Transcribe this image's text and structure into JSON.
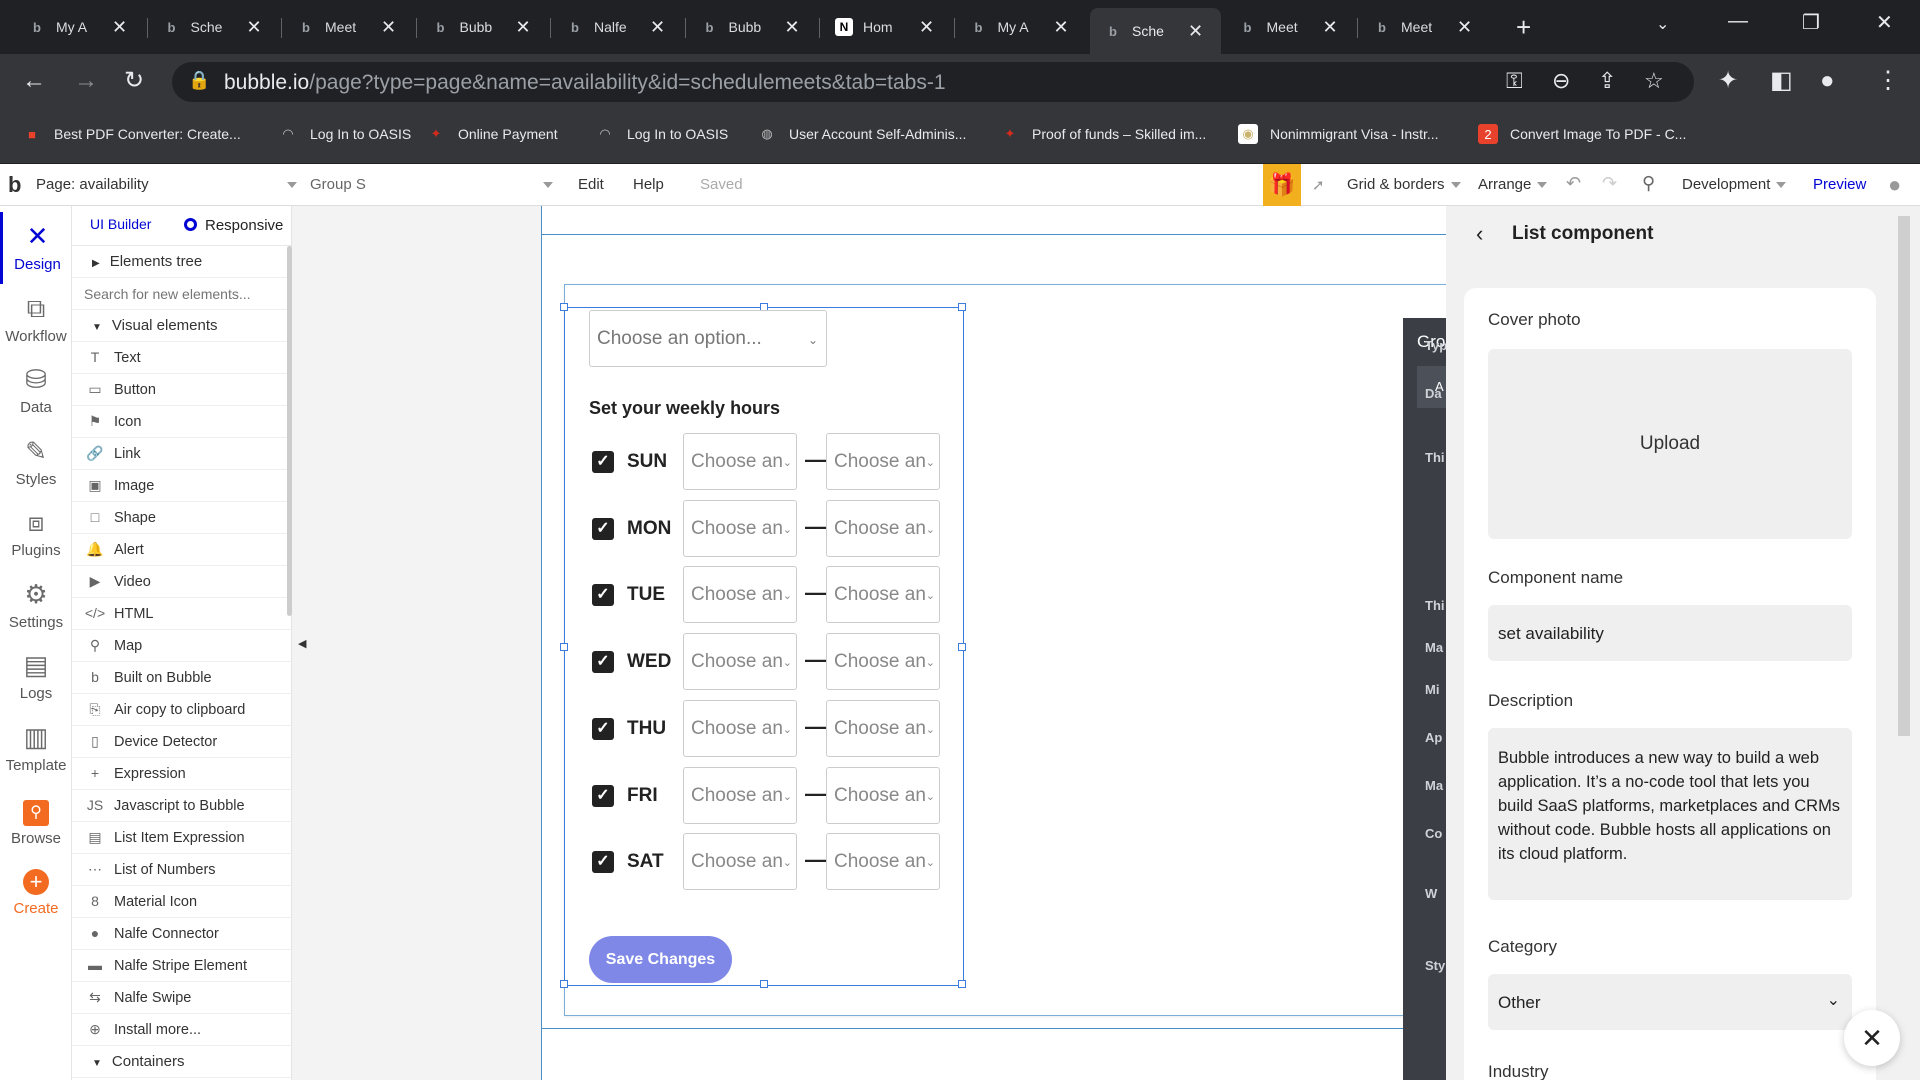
{
  "browser": {
    "tabs": [
      {
        "label": "My A",
        "icon": "b"
      },
      {
        "label": "Sche",
        "icon": "b"
      },
      {
        "label": "Meet",
        "icon": "b"
      },
      {
        "label": "Bubb",
        "icon": "b"
      },
      {
        "label": "Nalfe",
        "icon": "b"
      },
      {
        "label": "Bubb",
        "icon": "b"
      },
      {
        "label": "Hom",
        "icon": "N"
      },
      {
        "label": "My A",
        "icon": "b"
      },
      {
        "label": "Sche",
        "icon": "b"
      },
      {
        "label": "Meet",
        "icon": "b"
      },
      {
        "label": "Meet",
        "icon": "b"
      }
    ],
    "active_tab_index": 8,
    "url_host": "bubble.io",
    "url_path": "/page?type=page&name=availability&id=schedulemeets&tab=tabs-1",
    "bookmarks": [
      {
        "label": "Best PDF Converter: Create...",
        "icon": "pdf-icon"
      },
      {
        "label": "Log In to OASIS",
        "icon": "signal-icon"
      },
      {
        "label": "Online Payment",
        "icon": "maple-leaf-icon"
      },
      {
        "label": "Log In to OASIS",
        "icon": "signal-icon"
      },
      {
        "label": "User Account Self-Adminis...",
        "icon": "globe-icon"
      },
      {
        "label": "Proof of funds – Skilled im...",
        "icon": "maple-leaf-icon"
      },
      {
        "label": "Nonimmigrant Visa - Instr...",
        "icon": "seal-icon"
      },
      {
        "label": "Convert Image To PDF - C...",
        "icon": "convert-icon"
      }
    ]
  },
  "editor_header": {
    "page_label": "Page: availability",
    "group_label": "Group S",
    "menu_edit": "Edit",
    "menu_help": "Help",
    "save_status": "Saved",
    "grid_borders": "Grid & borders",
    "arrange": "Arrange",
    "environment": "Development",
    "preview": "Preview"
  },
  "rail": [
    {
      "label": "Design",
      "icon": "design-icon",
      "active": true
    },
    {
      "label": "Workflow",
      "icon": "workflow-icon"
    },
    {
      "label": "Data",
      "icon": "database-icon"
    },
    {
      "label": "Styles",
      "icon": "brush-icon"
    },
    {
      "label": "Plugins",
      "icon": "plugin-icon"
    },
    {
      "label": "Settings",
      "icon": "gear-icon"
    },
    {
      "label": "Logs",
      "icon": "document-icon"
    },
    {
      "label": "Template",
      "icon": "template-icon"
    },
    {
      "label": "Browse",
      "icon": "search-icon"
    },
    {
      "label": "Create",
      "icon": "plus-icon"
    }
  ],
  "palette": {
    "tab_ui_builder": "UI Builder",
    "tab_responsive": "Responsive",
    "elements_tree": "Elements tree",
    "search_placeholder": "Search for new elements...",
    "visual_elements": "Visual elements",
    "items": [
      {
        "label": "Text",
        "icon": "T"
      },
      {
        "label": "Button",
        "icon": "▭"
      },
      {
        "label": "Icon",
        "icon": "⚑"
      },
      {
        "label": "Link",
        "icon": "🔗"
      },
      {
        "label": "Image",
        "icon": "▣"
      },
      {
        "label": "Shape",
        "icon": "□"
      },
      {
        "label": "Alert",
        "icon": "🔔"
      },
      {
        "label": "Video",
        "icon": "▶"
      },
      {
        "label": "HTML",
        "icon": "</>"
      },
      {
        "label": "Map",
        "icon": "⚲"
      },
      {
        "label": "Built on Bubble",
        "icon": "b"
      },
      {
        "label": "Air copy to clipboard",
        "icon": "⎘"
      },
      {
        "label": "Device Detector",
        "icon": "▯"
      },
      {
        "label": "Expression",
        "icon": "+"
      },
      {
        "label": "Javascript to Bubble",
        "icon": "JS"
      },
      {
        "label": "List Item Expression",
        "icon": "▤"
      },
      {
        "label": "List of Numbers",
        "icon": "⋯"
      },
      {
        "label": "Material Icon",
        "icon": "8"
      },
      {
        "label": "Nalfe Connector",
        "icon": "●"
      },
      {
        "label": "Nalfe Stripe Element",
        "icon": "▬"
      },
      {
        "label": "Nalfe Swipe",
        "icon": "⇆"
      },
      {
        "label": "Install more...",
        "icon": "⊕"
      }
    ],
    "containers": "Containers"
  },
  "canvas": {
    "top_dropdown": "Choose an option...",
    "weekly_title": "Set your weekly hours",
    "days": [
      {
        "day": "SUN",
        "checked": true,
        "from": "Choose an",
        "to": "Choose an"
      },
      {
        "day": "MON",
        "checked": true,
        "from": "Choose an",
        "to": "Choose an"
      },
      {
        "day": "TUE",
        "checked": true,
        "from": "Choose an",
        "to": "Choose an"
      },
      {
        "day": "WED",
        "checked": true,
        "from": "Choose an",
        "to": "Choose an"
      },
      {
        "day": "THU",
        "checked": true,
        "from": "Choose an",
        "to": "Choose an"
      },
      {
        "day": "FRI",
        "checked": true,
        "from": "Choose an",
        "to": "Choose an"
      },
      {
        "day": "SAT",
        "checked": true,
        "from": "Choose an",
        "to": "Choose an"
      }
    ],
    "dash": "—",
    "save_button": "Save Changes",
    "group_panel_title": "Gro",
    "group_panel_tab": "A",
    "group_panel_labels": [
      "Typ",
      "Da",
      "Thi",
      "Thi",
      "Ma",
      "Mi",
      "Ap",
      "Ma",
      "Co",
      "W",
      "Sty"
    ]
  },
  "right_panel": {
    "title": "List component",
    "cover_photo_label": "Cover photo",
    "upload_label": "Upload",
    "component_name_label": "Component name",
    "component_name_value": "set availability",
    "description_label": "Description",
    "description_value": "Bubble introduces a new way to build a web application. It’s a no-code tool that lets you build SaaS platforms, marketplaces and CRMs without code. Bubble hosts all applications on its cloud platform.",
    "category_label": "Category",
    "category_value": "Other",
    "industry_label": "Industry"
  }
}
